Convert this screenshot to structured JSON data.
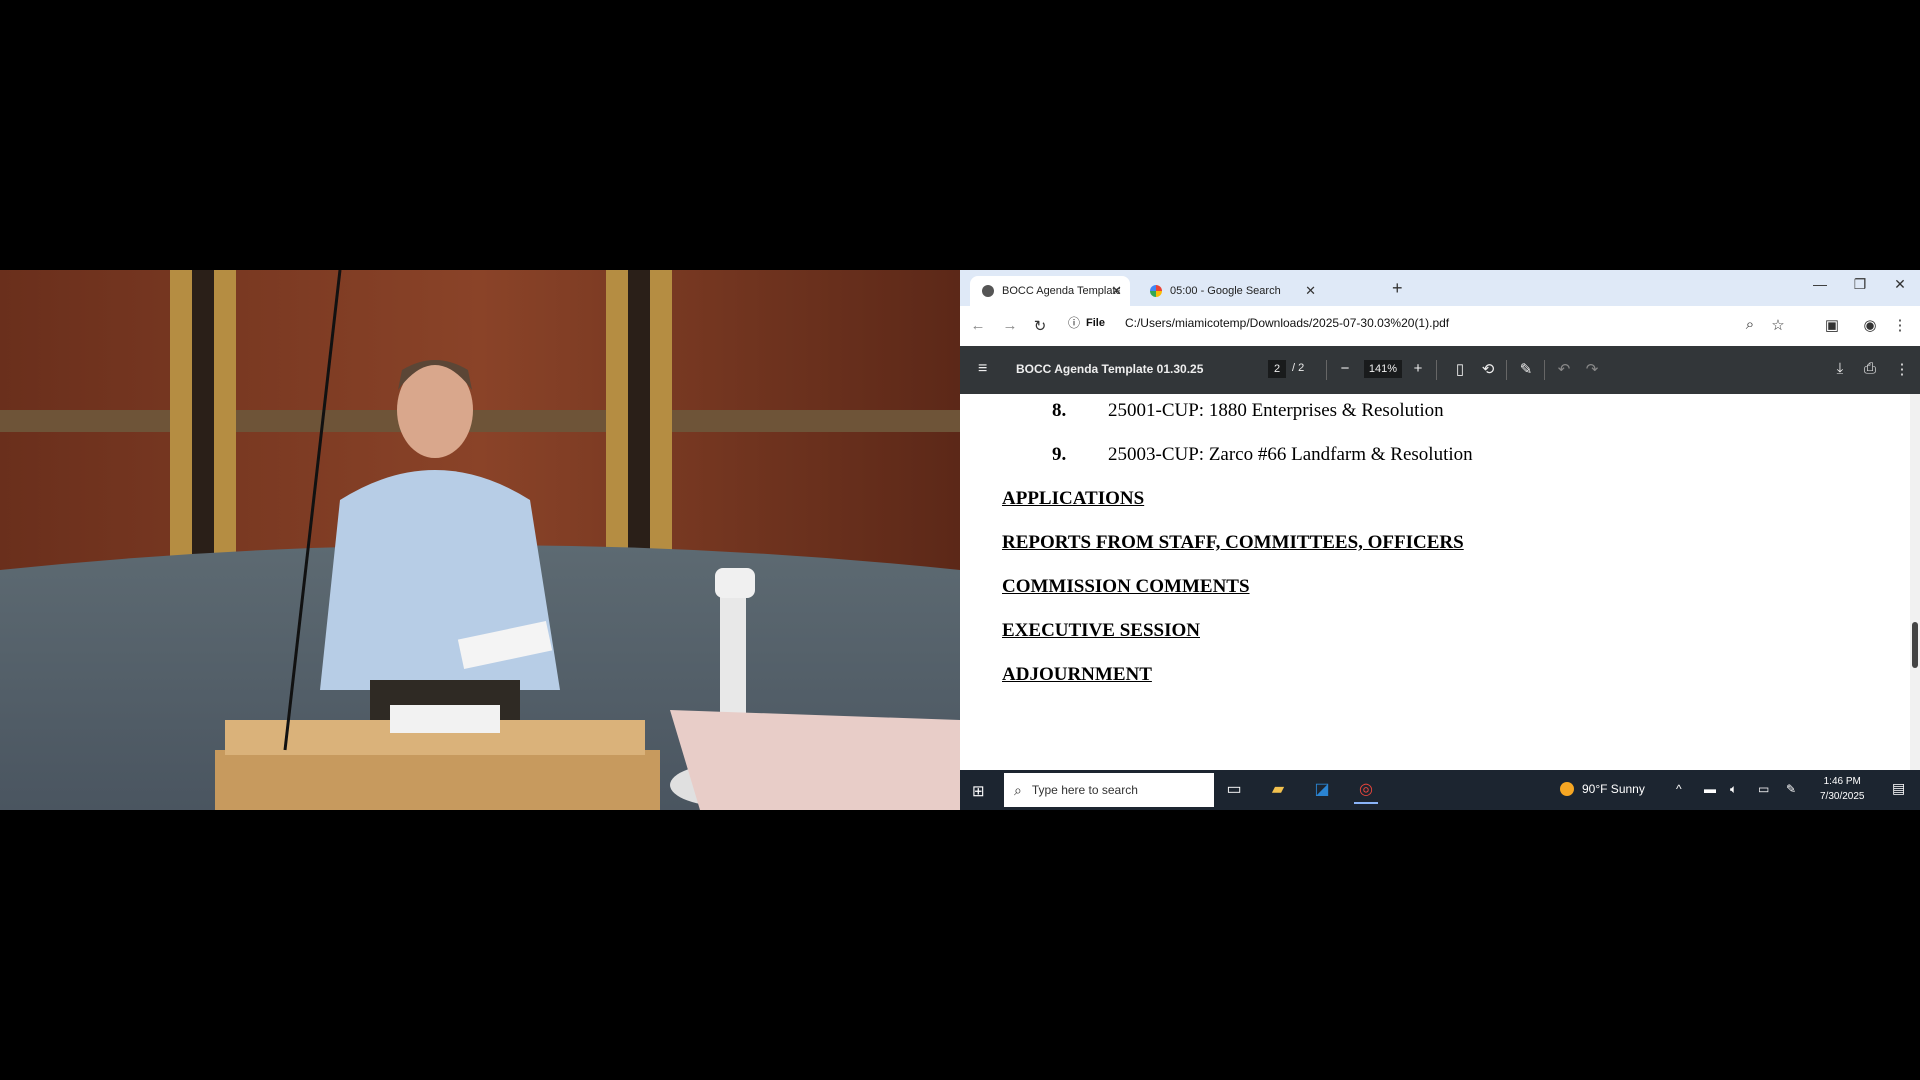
{
  "browser": {
    "tabs": [
      {
        "title": "BOCC Agenda Template 01.30.2",
        "active": true
      },
      {
        "title": "05:00 - Google Search",
        "active": false
      }
    ],
    "address": {
      "scheme_label": "File",
      "url": "C:/Users/miamicotemp/Downloads/2025-07-30.03%20(1).pdf"
    }
  },
  "pdf_toolbar": {
    "title": "BOCC Agenda Template 01.30.25",
    "current_page": "2",
    "total_pages": "/ 2",
    "zoom": "141%"
  },
  "pdf_content": {
    "items": [
      {
        "number": "8.",
        "text": "25001-CUP: 1880 Enterprises & Resolution"
      },
      {
        "number": "9.",
        "text": "25003-CUP: Zarco #66 Landfarm & Resolution"
      }
    ],
    "headings": [
      "APPLICATIONS",
      "REPORTS FROM STAFF, COMMITTEES, OFFICERS",
      "COMMISSION COMMENTS",
      "EXECUTIVE SESSION",
      "ADJOURNMENT"
    ]
  },
  "taskbar": {
    "search_placeholder": "Type here to search",
    "weather": "90°F  Sunny",
    "time": "1:46 PM",
    "date": "7/30/2025"
  },
  "icons": {
    "tab_favicon_1": "globe-icon",
    "tab_favicon_2": "google-icon",
    "start": "windows-icon"
  }
}
